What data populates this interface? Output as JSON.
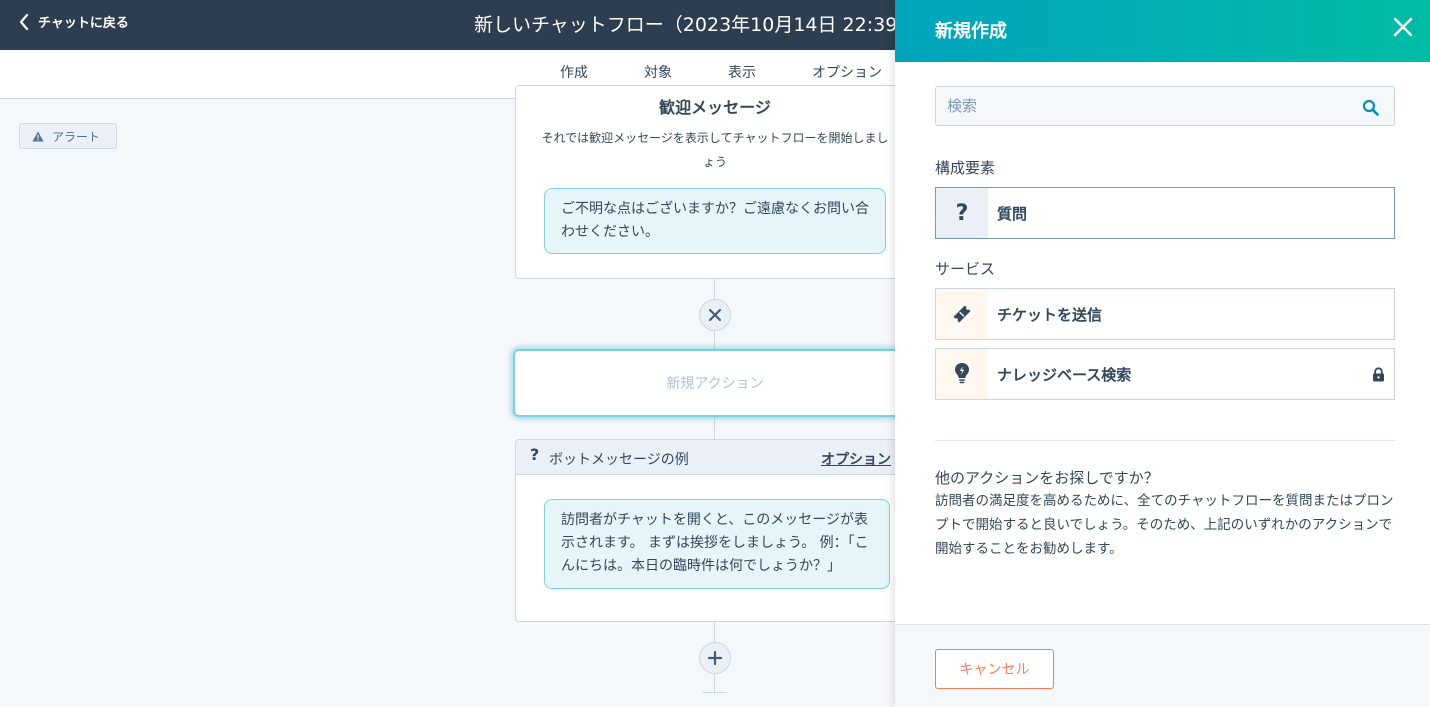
{
  "header": {
    "back_label": "チャットに戻る",
    "title": "新しいチャットフロー（2023年10月14日 22:39"
  },
  "tabs": [
    {
      "label": "作成",
      "active": true
    },
    {
      "label": "対象"
    },
    {
      "label": "表示"
    },
    {
      "label": "オプション"
    }
  ],
  "alert": {
    "label": "アラート"
  },
  "canvas": {
    "welcome": {
      "title": "歓迎メッセージ",
      "description": "それでは歓迎メッセージを表示してチャットフローを開始しましょう",
      "bubble": "ご不明な点はございますか？ご遠慮なくお問い合わせください。"
    },
    "new_action": "新規アクション",
    "bot_message": {
      "icon": "?",
      "label": "ボットメッセージの例",
      "options_label": "オプション",
      "bubble": "訪問者がチャットを開くと、このメッセージが表示されます。 まずは挨拶をしましょう。 例：「こんにちは。本日の臨時件は何でしょうか？」"
    }
  },
  "panel": {
    "title": "新規作成",
    "search_placeholder": "検索",
    "components_section": "構成要素",
    "components": [
      {
        "label": "質問",
        "icon": "question-icon"
      }
    ],
    "services_section": "サービス",
    "services": [
      {
        "label": "チケットを送信",
        "icon": "ticket-icon"
      },
      {
        "label": "ナレッジベース検索",
        "icon": "lightbulb-icon",
        "locked": true
      }
    ],
    "more_title": "他のアクションをお探しですか？",
    "more_desc": "訪問者の満足度を高めるために、全てのチャットフローを質問またはプロンプトで開始すると良いでしょう。そのため、上記のいずれかのアクションで開始することをお勧めします。",
    "cancel_label": "キャンセル"
  },
  "colors": {
    "header_bg": "#2d3e50",
    "panel_gradient_start": "#00a4bd",
    "panel_gradient_end": "#00bda5",
    "bubble_bg": "#e5f5f8",
    "cancel_accent": "#ff7a59"
  }
}
